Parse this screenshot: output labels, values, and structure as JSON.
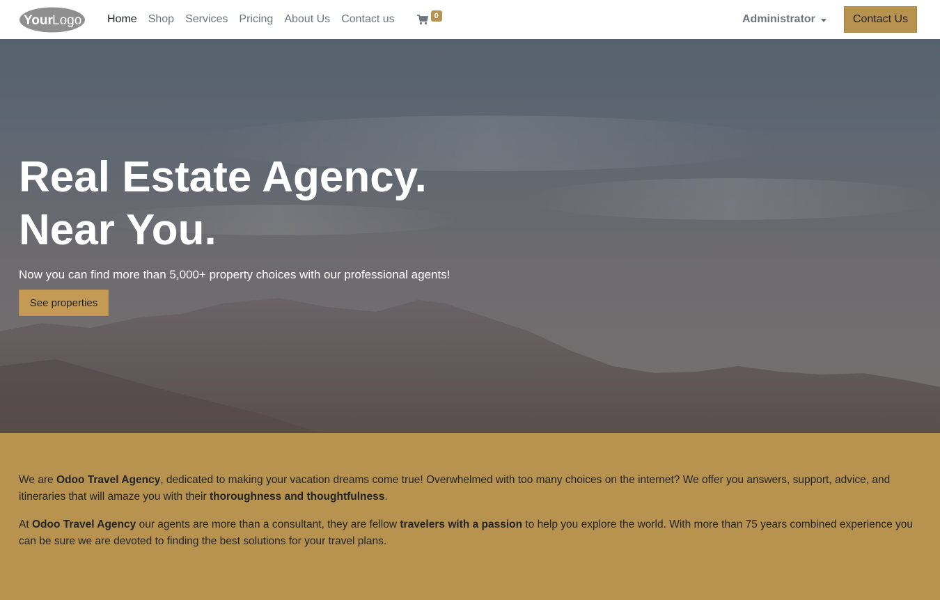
{
  "header": {
    "logo_alt": "YourLogo",
    "nav": [
      {
        "label": "Home"
      },
      {
        "label": "Shop"
      },
      {
        "label": "Services"
      },
      {
        "label": "Pricing"
      },
      {
        "label": "About Us"
      },
      {
        "label": "Contact us"
      }
    ],
    "cart_count": "0",
    "user_menu": "Administrator",
    "cta_label": "Contact Us"
  },
  "hero": {
    "title_line1": "Real Estate Agency.",
    "title_line2": "Near You.",
    "subtitle": "Now you can find more than 5,000+ property choices with our professional agents!",
    "cta_label": "See properties"
  },
  "about": {
    "p1_pre": "We are ",
    "p1_bold1": "Odoo Travel Agency",
    "p1_mid": ", dedicated to making your vacation dreams come true! Overwhelmed with too many choices on the internet? We offer you answers, support, advice, and itineraries that will amaze you with their ",
    "p1_bold2": "thoroughness and thoughtfulness",
    "p1_end": ".",
    "p2_pre": "At ",
    "p2_bold1": "Odoo Travel Agency",
    "p2_mid": " our agents are more than a consultant, they are fellow ",
    "p2_bold2": "travelers with a passion",
    "p2_end": " to help you explore the world. With more than 75 years combined experience you can be sure we are devoted to finding the best solutions for your travel plans."
  },
  "colors": {
    "accent": "#b8924f",
    "text": "#212529",
    "muted": "#6c757d"
  }
}
